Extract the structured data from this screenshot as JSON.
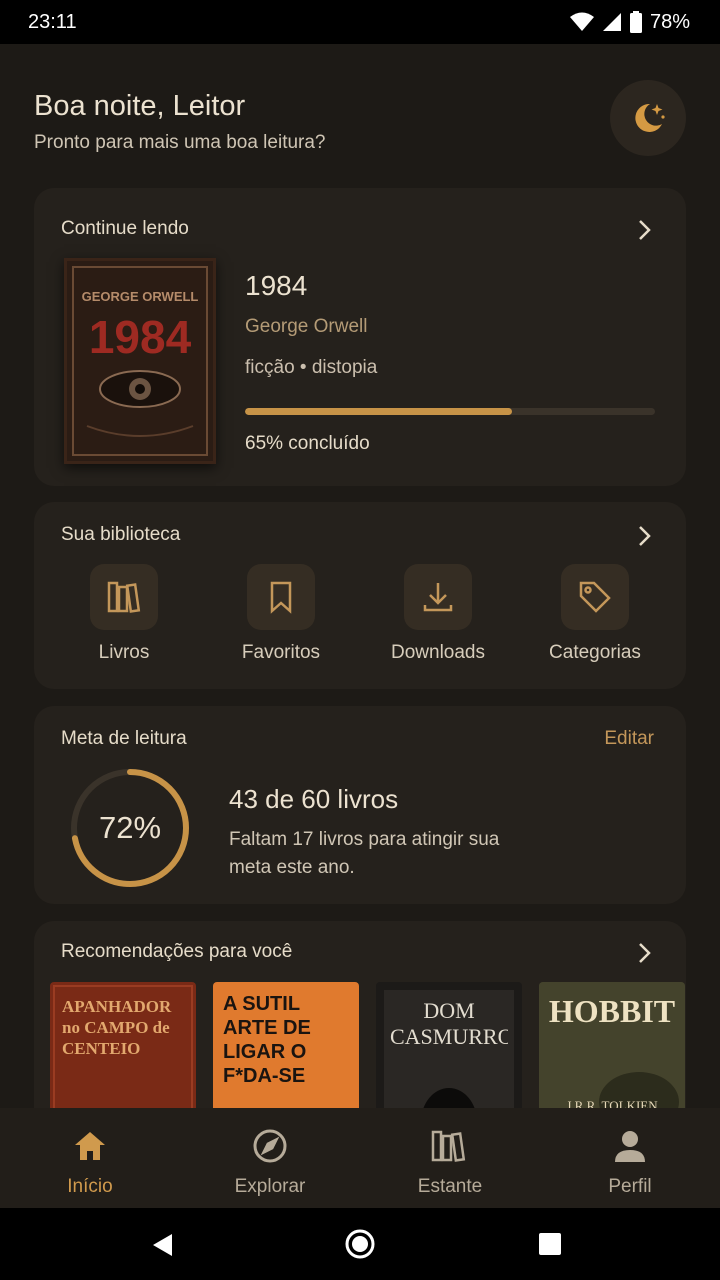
{
  "status": {
    "time": "23:11",
    "battery": "78%"
  },
  "header": {
    "greeting": "Boa noite, Leitor",
    "subtitle": "Pronto para mais uma boa leitura?",
    "theme_icon": "moon-stars-icon"
  },
  "continue_reading": {
    "title": "Continue lendo",
    "book": {
      "title": "1984",
      "author": "George Orwell",
      "genres": "ficção • distopia",
      "progress": 0.65,
      "progress_label": "65% concluído",
      "cover_author": "GEORGE ORWELL",
      "cover_title": "1984"
    }
  },
  "library": {
    "title": "Sua biblioteca",
    "items": [
      {
        "label": "Livros",
        "icon": "books-icon"
      },
      {
        "label": "Favoritos",
        "icon": "bookmark-icon"
      },
      {
        "label": "Downloads",
        "icon": "download-icon"
      },
      {
        "label": "Categorias",
        "icon": "tag-icon"
      }
    ]
  },
  "goal": {
    "title": "Meta de leitura",
    "edit_label": "Editar",
    "percent": 0.72,
    "percent_label": "72%",
    "count": "43 de 60 livros",
    "description": "Faltam 17 livros para atingir sua meta este ano."
  },
  "recommendations": {
    "title": "Recomendações para você",
    "books": [
      {
        "cover_text": "APANHADOR no CAMPO de CENTEIO"
      },
      {
        "cover_text": "A SUTIL ARTE DE LIGAR O F*DA-SE"
      },
      {
        "cover_text": "DOM CASMURRO"
      },
      {
        "cover_text": "HOBBIT",
        "cover_author": "J.R.R. TOLKIEN"
      }
    ]
  },
  "bottom_nav": {
    "items": [
      {
        "label": "Início",
        "icon": "home-icon",
        "active": true
      },
      {
        "label": "Explorar",
        "icon": "compass-icon",
        "active": false
      },
      {
        "label": "Estante",
        "icon": "bookshelf-icon",
        "active": false
      },
      {
        "label": "Perfil",
        "icon": "person-icon",
        "active": false
      }
    ]
  },
  "colors": {
    "accent": "#c79347",
    "background": "#1d1a16",
    "card": "#25211c"
  }
}
